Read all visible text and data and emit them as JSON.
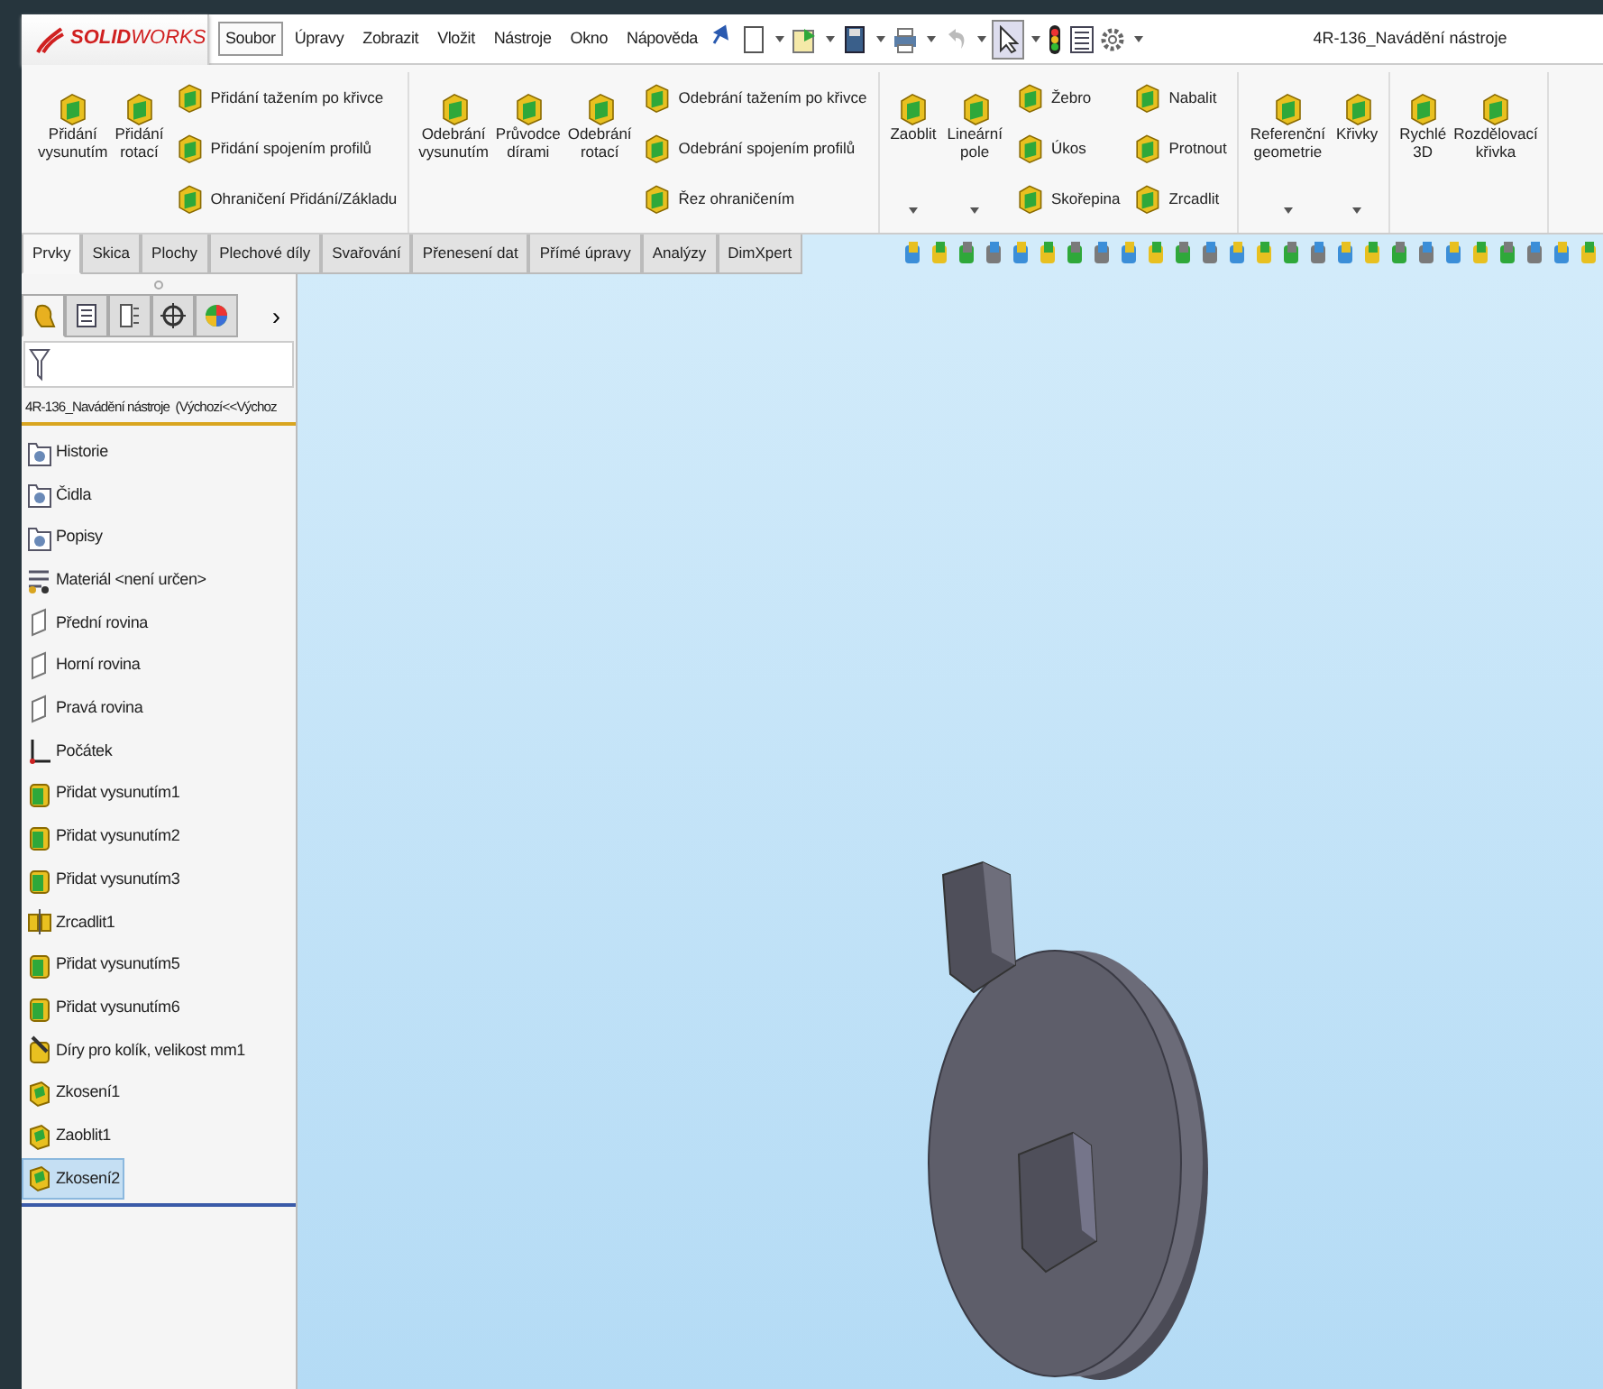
{
  "app": {
    "logo": "**SOLID**WORKS"
  },
  "menu": [
    {
      "label": "Soubor",
      "selected": true
    },
    {
      "label": "Úpravy",
      "selected": false
    },
    {
      "label": "Zobrazit",
      "selected": false
    },
    {
      "label": "Vložit",
      "selected": false
    },
    {
      "label": "Nástroje",
      "selected": false
    },
    {
      "label": "Okno",
      "selected": false
    },
    {
      "label": "Nápověda",
      "selected": false
    }
  ],
  "window": {
    "title": "4R-136_Navádění nástroje"
  },
  "ribbon_groups": [
    {
      "columns": [
        {
          "kind": "large",
          "items": [
            "Přidání\nvysunutím"
          ]
        },
        {
          "kind": "large",
          "items": [
            "Přidání\nrotací"
          ]
        },
        {
          "kind": "small",
          "items": [
            "Přidání tažením po křivce",
            "Přidání spojením profilů",
            "Ohraničení Přidání/Základu"
          ]
        }
      ]
    },
    {
      "columns": [
        {
          "kind": "large",
          "items": [
            "Odebrání\nvysunutím"
          ]
        },
        {
          "kind": "large",
          "items": [
            "Průvodce\ndírami"
          ]
        },
        {
          "kind": "large",
          "items": [
            "Odebrání\nrotací"
          ]
        },
        {
          "kind": "small",
          "items": [
            "Odebrání tažením po křivce",
            "Odebrání spojením profilů",
            "Řez ohraničením"
          ]
        }
      ]
    },
    {
      "columns": [
        {
          "kind": "dropdown",
          "items": [
            "Zaoblit"
          ]
        },
        {
          "kind": "dropdown",
          "items": [
            "Lineární\npole"
          ]
        },
        {
          "kind": "small",
          "items": [
            "Žebro",
            "Úkos",
            "Skořepina"
          ]
        },
        {
          "kind": "small",
          "items": [
            "Nabalit",
            "Protnout",
            "Zrcadlit"
          ]
        }
      ]
    },
    {
      "columns": [
        {
          "kind": "dropdown",
          "items": [
            "Referenční\ngeometrie"
          ]
        },
        {
          "kind": "dropdown",
          "items": [
            "Křivky"
          ]
        }
      ]
    },
    {
      "columns": [
        {
          "kind": "large",
          "items": [
            "Rychlé\n3D"
          ]
        },
        {
          "kind": "large",
          "items": [
            "Rozdělovací\nkřivka"
          ]
        }
      ]
    }
  ],
  "tabs": [
    {
      "label": "Prvky",
      "selected": true
    },
    {
      "label": "Skica",
      "selected": false
    },
    {
      "label": "Plochy",
      "selected": false
    },
    {
      "label": "Plechové díly",
      "selected": false
    },
    {
      "label": "Svařování",
      "selected": false
    },
    {
      "label": "Přenesení dat",
      "selected": false
    },
    {
      "label": "Přímé úpravy",
      "selected": false
    },
    {
      "label": "Analýzy",
      "selected": false
    },
    {
      "label": "DimXpert",
      "selected": false
    }
  ],
  "panel_tabs": [
    {
      "selected": true
    },
    {
      "selected": false
    },
    {
      "selected": false
    },
    {
      "selected": false
    },
    {
      "selected": false
    }
  ],
  "panel_more": "›",
  "tree": {
    "header": "4R-136_Navádění nástroje  (Výchozí<<Výchoz",
    "items": [
      {
        "label": "Historie",
        "kind": "folder",
        "selected": false
      },
      {
        "label": "Čidla",
        "kind": "folder",
        "selected": false
      },
      {
        "label": "Popisy",
        "kind": "folder",
        "selected": false
      },
      {
        "label": "Materiál <není určen>",
        "kind": "material",
        "selected": false
      },
      {
        "label": "Přední rovina",
        "kind": "plane",
        "selected": false
      },
      {
        "label": "Horní rovina",
        "kind": "plane",
        "selected": false
      },
      {
        "label": "Pravá rovina",
        "kind": "plane",
        "selected": false
      },
      {
        "label": "Počátek",
        "kind": "origin",
        "selected": false
      },
      {
        "label": "Přidat vysunutím1",
        "kind": "extrude",
        "selected": false
      },
      {
        "label": "Přidat vysunutím2",
        "kind": "extrude",
        "selected": false
      },
      {
        "label": "Přidat vysunutím3",
        "kind": "extrude",
        "selected": false
      },
      {
        "label": "Zrcadlit1",
        "kind": "mirror",
        "selected": false
      },
      {
        "label": "Přidat vysunutím5",
        "kind": "extrude",
        "selected": false
      },
      {
        "label": "Přidat vysunutím6",
        "kind": "extrude",
        "selected": false
      },
      {
        "label": "Díry pro kolík, velikost mm1",
        "kind": "hole",
        "selected": false
      },
      {
        "label": "Zkosení1",
        "kind": "feature",
        "selected": false
      },
      {
        "label": "Zaoblit1",
        "kind": "feature",
        "selected": false
      },
      {
        "label": "Zkosení2",
        "kind": "feature",
        "selected": true
      }
    ]
  }
}
